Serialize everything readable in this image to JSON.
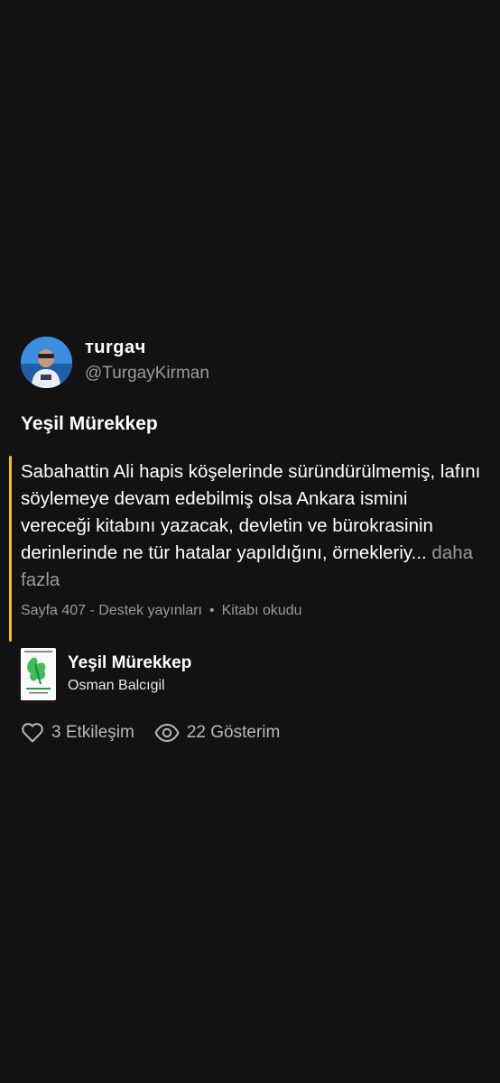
{
  "user": {
    "display_name": "тurgaч",
    "handle": "@TurgayKirman",
    "avatar_icon": "user-avatar-photo"
  },
  "post": {
    "book_title": "Yeşil Mürekkep",
    "quote_text": "Sabahattin Ali hapis köşelerinde süründürülmemiş, lafını söylemeye devam edebilmiş olsa Ankara ismini vereceği kitabını yazacak, devletin ve bürokrasinin derinlerinde ne tür hatalar yapıldığını, örnekleriy...",
    "more_label": " daha fazla",
    "page_info": "Sayfa 407 - Destek yayınları",
    "separator": "•",
    "read_status": "Kitabı okudu",
    "accent_color": "#f0c419"
  },
  "book": {
    "title": "Yeşil Mürekkep",
    "author": "Osman Balcıgil"
  },
  "stats": {
    "likes_label": "3 Etkileşim",
    "views_label": "22 Gösterim"
  }
}
